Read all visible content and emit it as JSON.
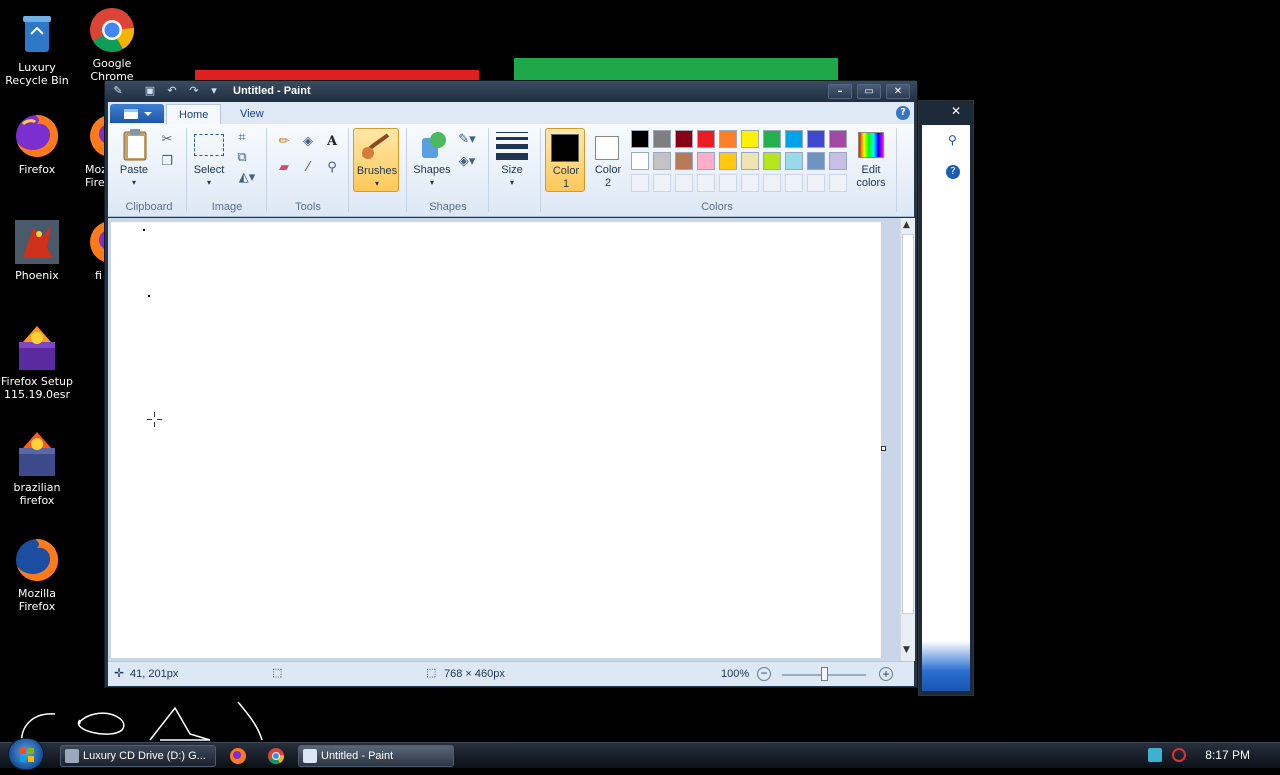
{
  "desktop": {
    "icons": [
      {
        "label": "Luxury Recycle Bin",
        "icon": "recycle-bin-icon"
      },
      {
        "label": "Google Chrome",
        "icon": "chrome-icon"
      },
      {
        "label": "Firefox",
        "icon": "firefox-icon"
      },
      {
        "label": "Mozilla Firefox",
        "icon": "firefox-icon"
      },
      {
        "label": "Phoenix",
        "icon": "phoenix-icon"
      },
      {
        "label": "fi",
        "icon": "firefox-icon"
      },
      {
        "label": "Firefox Setup 115.19.0esr",
        "icon": "installer-icon"
      },
      {
        "label": "brazilian firefox",
        "icon": "installer-icon"
      },
      {
        "label": "Mozilla Firefox",
        "icon": "firefox-icon"
      }
    ],
    "bg_bar_colors": [
      "#e0201f",
      "#1ea84a"
    ]
  },
  "paint": {
    "title": "Untitled - Paint",
    "tabs": {
      "home": "Home",
      "view": "View"
    },
    "clipboard": {
      "paste": "Paste",
      "group": "Clipboard"
    },
    "image": {
      "select": "Select",
      "group": "Image"
    },
    "tools": {
      "group": "Tools",
      "text_glyph": "A"
    },
    "brushes": {
      "label": "Brushes"
    },
    "shapes": {
      "label": "Shapes",
      "group": "Shapes"
    },
    "size": {
      "label": "Size"
    },
    "colors": {
      "color1_label": "Color",
      "color1_num": "1",
      "color2_label": "Color",
      "color2_num": "2",
      "edit_line1": "Edit",
      "edit_line2": "colors",
      "group": "Colors",
      "color1": "#000000",
      "color2": "#ffffff",
      "palette_row1": [
        "#000000",
        "#7f7f7f",
        "#880015",
        "#ed1c24",
        "#ff7f27",
        "#fff200",
        "#22b14c",
        "#00a2e8",
        "#3f48cc",
        "#a349a4"
      ],
      "palette_row2": [
        "#ffffff",
        "#c3c3c3",
        "#b97a57",
        "#ffaec9",
        "#ffc90e",
        "#efe4b0",
        "#b5e61d",
        "#99d9ea",
        "#7092be",
        "#c8bfe7"
      ]
    },
    "status": {
      "cursor_pos": "41, 201px",
      "canvas_size": "768 × 460px",
      "zoom": "100%",
      "zoom_level_fraction": 0.5
    }
  },
  "taskbar": {
    "items": [
      {
        "label": "Luxury CD Drive (D:) G...",
        "icon": "drive-icon"
      },
      {
        "label": "",
        "icon": "firefox-icon"
      },
      {
        "label": "",
        "icon": "chrome-icon"
      },
      {
        "label": "Untitled - Paint",
        "icon": "paint-icon"
      }
    ],
    "clock": "8:17 PM"
  }
}
